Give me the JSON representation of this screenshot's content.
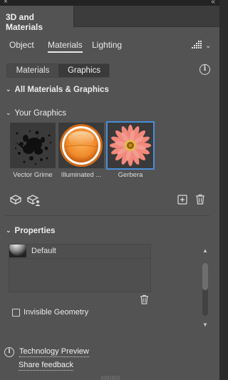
{
  "window": {
    "close_glyph": "×",
    "collapse_glyph": "‹‹"
  },
  "panel": {
    "title": "3D and Materials"
  },
  "tabs": [
    {
      "label": "Object",
      "active": false
    },
    {
      "label": "Materials",
      "active": true
    },
    {
      "label": "Lighting",
      "active": false
    }
  ],
  "toolbar": {
    "render_icon": "render-grid-icon",
    "menu_glyph": "⌄"
  },
  "segments": [
    {
      "label": "Materials",
      "active": false
    },
    {
      "label": "Graphics",
      "active": true
    }
  ],
  "info_glyph": "i",
  "sections": {
    "all": {
      "label": "All Materials & Graphics",
      "chevron": "⌄"
    },
    "your_graphics": {
      "label": "Your Graphics",
      "chevron": "⌄"
    },
    "properties": {
      "label": "Properties",
      "chevron": "⌄"
    }
  },
  "graphics": [
    {
      "label": "Vector Grime",
      "selected": false,
      "icon": "grime-splatter"
    },
    {
      "label": "Illuminated ...",
      "selected": false,
      "icon": "orange-button"
    },
    {
      "label": "Gerbera",
      "selected": true,
      "icon": "gerbera-flower"
    }
  ],
  "properties": {
    "items": [
      {
        "label": "Default",
        "icon": "sphere-material"
      }
    ]
  },
  "invisible_geometry": {
    "label": "Invisible Geometry",
    "checked": false
  },
  "footer": {
    "technology_preview": "Technology Preview",
    "share_feedback": "Share feedback"
  },
  "colors": {
    "panel_bg": "#535353",
    "header_bg": "#3c3c3c",
    "selection_outline": "#4a8dd8",
    "gerbera_petal": "#f28a7e",
    "gerbera_center": "#e7b84b",
    "button_orange": "#f08a2a"
  }
}
